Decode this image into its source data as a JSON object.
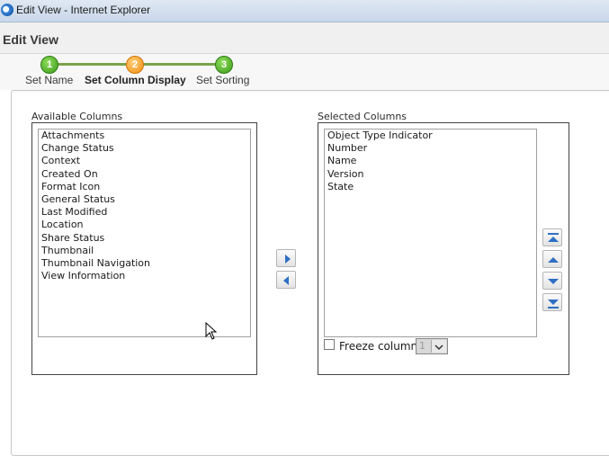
{
  "window": {
    "title": "Edit View - Internet Explorer",
    "app_icon": "internet-explorer-icon"
  },
  "header": {
    "page_title": "Edit View"
  },
  "wizard": {
    "steps": [
      {
        "number": "1",
        "label": "Set Name",
        "state": "completed",
        "color": "#3a9b1a"
      },
      {
        "number": "2",
        "label": "Set Column Display",
        "state": "current",
        "color": "#f08d10"
      },
      {
        "number": "3",
        "label": "Set Sorting",
        "state": "pending",
        "color": "#3a9b1a"
      }
    ]
  },
  "available": {
    "heading": "Available Columns",
    "items": [
      "Attachments",
      "Change Status",
      "Context",
      "Created On",
      "Format Icon",
      "General Status",
      "Last Modified",
      "Location",
      "Share Status",
      "Thumbnail",
      "Thumbnail Navigation",
      "View Information"
    ]
  },
  "transfer": {
    "add_icon": "arrow-right-icon",
    "remove_icon": "arrow-left-icon"
  },
  "selected": {
    "heading": "Selected Columns",
    "items": [
      "Object Type Indicator",
      "Number",
      "Name",
      "Version",
      "State"
    ]
  },
  "order_buttons": [
    "move-top-icon",
    "move-up-icon",
    "move-down-icon",
    "move-bottom-icon"
  ],
  "freeze": {
    "label": "Freeze column",
    "checked": false,
    "value": "1"
  }
}
